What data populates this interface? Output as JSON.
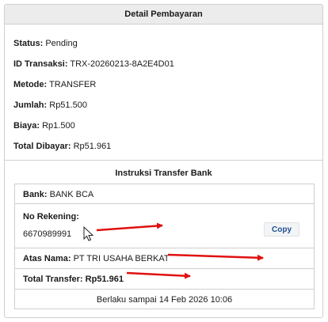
{
  "header": {
    "title": "Detail Pembayaran"
  },
  "details": [
    {
      "label": "Status:",
      "value": "Pending"
    },
    {
      "label": "ID Transaksi:",
      "value": "TRX-20260213-8A2E4D01"
    },
    {
      "label": "Metode:",
      "value": "TRANSFER"
    },
    {
      "label": "Jumlah:",
      "value": "Rp51.500"
    },
    {
      "label": "Biaya:",
      "value": "Rp1.500"
    },
    {
      "label": "Total Dibayar:",
      "value": "Rp51.961"
    }
  ],
  "instructions": {
    "title": "Instruksi Transfer Bank",
    "bank_label": "Bank:",
    "bank_value": "BANK BCA",
    "account_label": "No Rekening:",
    "account_value": "6670989991",
    "copy_label": "Copy",
    "name_label": "Atas Nama:",
    "name_value": "PT TRI USAHA BERKAT",
    "total_label": "Total Transfer:",
    "total_value": "Rp51.961",
    "valid_until": "Berlaku sampai 14 Feb 2026 10:06"
  },
  "colors": {
    "arrow": "#e01010",
    "copy_text": "#1f4f8f"
  }
}
